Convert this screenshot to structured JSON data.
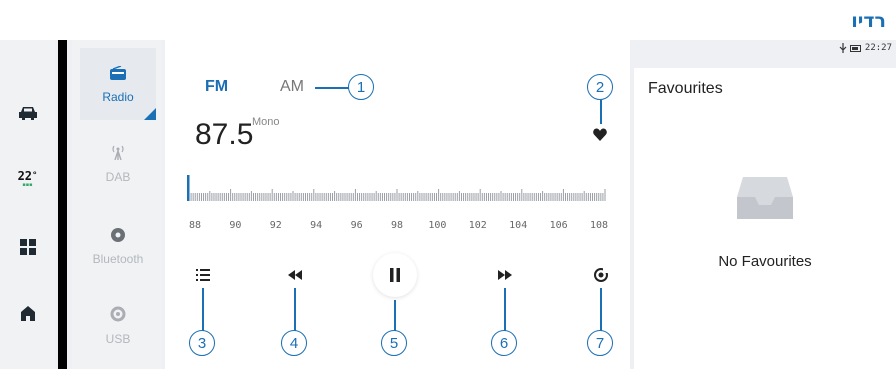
{
  "heading": "רדיו",
  "status": {
    "time": "22:27"
  },
  "rail": {
    "items": [
      {
        "icon": "car-icon"
      },
      {
        "icon": "climate-temp",
        "temp": "22",
        "unit": "°"
      },
      {
        "icon": "apps-grid-icon"
      },
      {
        "icon": "home-icon"
      }
    ]
  },
  "sources": [
    {
      "label": "Radio",
      "icon": "radio-icon",
      "active": true
    },
    {
      "label": "DAB",
      "icon": "antenna-icon",
      "active": false
    },
    {
      "label": "Bluetooth",
      "icon": "bluetooth-disc-icon",
      "active": false
    },
    {
      "label": "USB",
      "icon": "usb-disc-icon",
      "active": false
    }
  ],
  "radio": {
    "band_fm": "FM",
    "band_am": "AM",
    "frequency": "87.5",
    "mode": "Mono",
    "scale": [
      "88",
      "90",
      "92",
      "94",
      "96",
      "98",
      "100",
      "102",
      "104",
      "106",
      "108"
    ]
  },
  "callouts": [
    "1",
    "2",
    "3",
    "4",
    "5",
    "6",
    "7"
  ],
  "favourites": {
    "title": "Favourites",
    "empty_text": "No Favourites"
  },
  "colors": {
    "accent": "#1a6fb5",
    "panel": "#ffffff",
    "background": "#eef0f3"
  }
}
